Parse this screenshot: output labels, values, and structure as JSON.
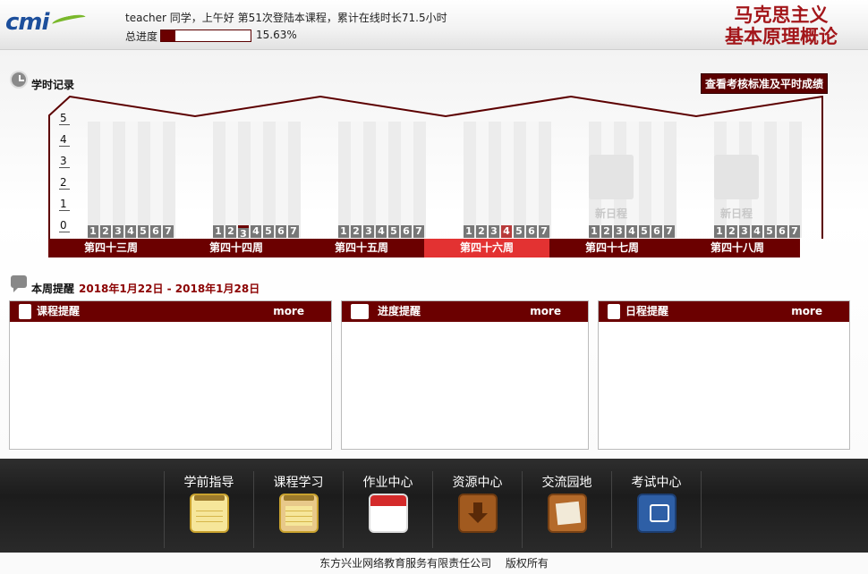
{
  "header": {
    "logo_text": "cmi",
    "greeting": "teacher 同学，上午好 第51次登陆本课程，累计在线时长71.5小时",
    "progress_label": "总进度",
    "progress_value": "15.63%",
    "progress_fraction": 0.1563,
    "brand_line1": "马克思主义",
    "brand_line2": "基本原理概论"
  },
  "study_record": {
    "title": "学时记录",
    "standard_button": "查看考核标准及平时成绩",
    "y_ticks": [
      "5",
      "4",
      "3",
      "2",
      "1",
      "0"
    ],
    "days": [
      "1",
      "2",
      "3",
      "4",
      "5",
      "6",
      "7"
    ],
    "weeks": [
      {
        "label": "第四十三周",
        "current": false,
        "new_schedule": ""
      },
      {
        "label": "第四十四周",
        "current": false,
        "new_schedule": ""
      },
      {
        "label": "第四十五周",
        "current": false,
        "new_schedule": ""
      },
      {
        "label": "第四十六周",
        "current": true,
        "new_schedule": ""
      },
      {
        "label": "第四十七周",
        "current": false,
        "new_schedule": "新日程"
      },
      {
        "label": "第四十八周",
        "current": false,
        "new_schedule": "新日程"
      }
    ]
  },
  "weekly_reminder": {
    "title": "本周提醒",
    "date_range": "2018年1月22日 - 2018年1月28日",
    "panels": [
      {
        "title": "课程提醒",
        "more": "more"
      },
      {
        "title": "进度提醒",
        "more": "more"
      },
      {
        "title": "日程提醒",
        "more": "more"
      }
    ]
  },
  "nav": {
    "items": [
      {
        "label": "学前指导",
        "icon": "notepad-icon"
      },
      {
        "label": "课程学习",
        "icon": "notepad-icon"
      },
      {
        "label": "作业中心",
        "icon": "calendar-icon"
      },
      {
        "label": "资源中心",
        "icon": "download-icon"
      },
      {
        "label": "交流园地",
        "icon": "chat-icon"
      },
      {
        "label": "考试中心",
        "icon": "book-icon"
      }
    ]
  },
  "footer": {
    "copyright": "东方兴业网络教育服务有限责任公司　 版权所有"
  },
  "colors": {
    "accent": "#6b0000",
    "current_week": "#e33232",
    "brand": "#a3161a"
  }
}
